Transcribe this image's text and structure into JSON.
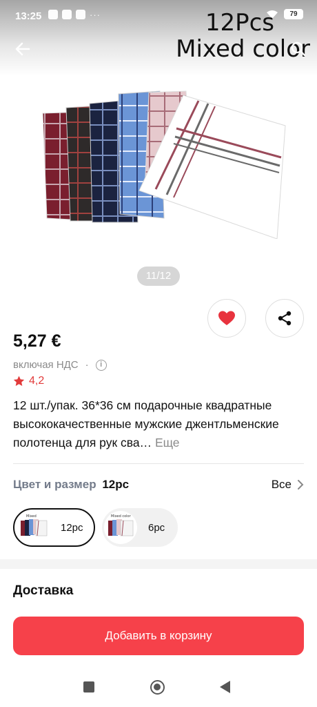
{
  "status_bar": {
    "time": "13:25",
    "battery": "79",
    "more": "···"
  },
  "image_overlay": {
    "line1": "12Pcs",
    "line2": "Mixed color"
  },
  "gallery": {
    "counter": "11/12"
  },
  "product": {
    "price": "5,27 €",
    "vat": "включая НДС",
    "vat_separator": "·",
    "rating": "4,2",
    "description": "12 шт./упак. 36*36 см подарочные квадратные высококачественные мужские джентльменские полотенца для рук сва…",
    "more_label": "Еще"
  },
  "variant": {
    "label": "Цвет и размер",
    "selected": "12pc",
    "all_label": "Все",
    "options": [
      {
        "label": "12pc",
        "thumb_text": "Mixed"
      },
      {
        "label": "6pc",
        "thumb_text": "Mixed color"
      }
    ]
  },
  "delivery": {
    "title": "Доставка"
  },
  "cart": {
    "button_label": "Добавить в корзину"
  },
  "colors": {
    "accent": "#f6414a",
    "rating": "#e23b3b",
    "heart": "#e8333e"
  },
  "icons": [
    "back-arrow-icon",
    "search-icon",
    "heart-icon",
    "share-icon",
    "info-icon",
    "star-icon",
    "chevron-right-icon"
  ]
}
